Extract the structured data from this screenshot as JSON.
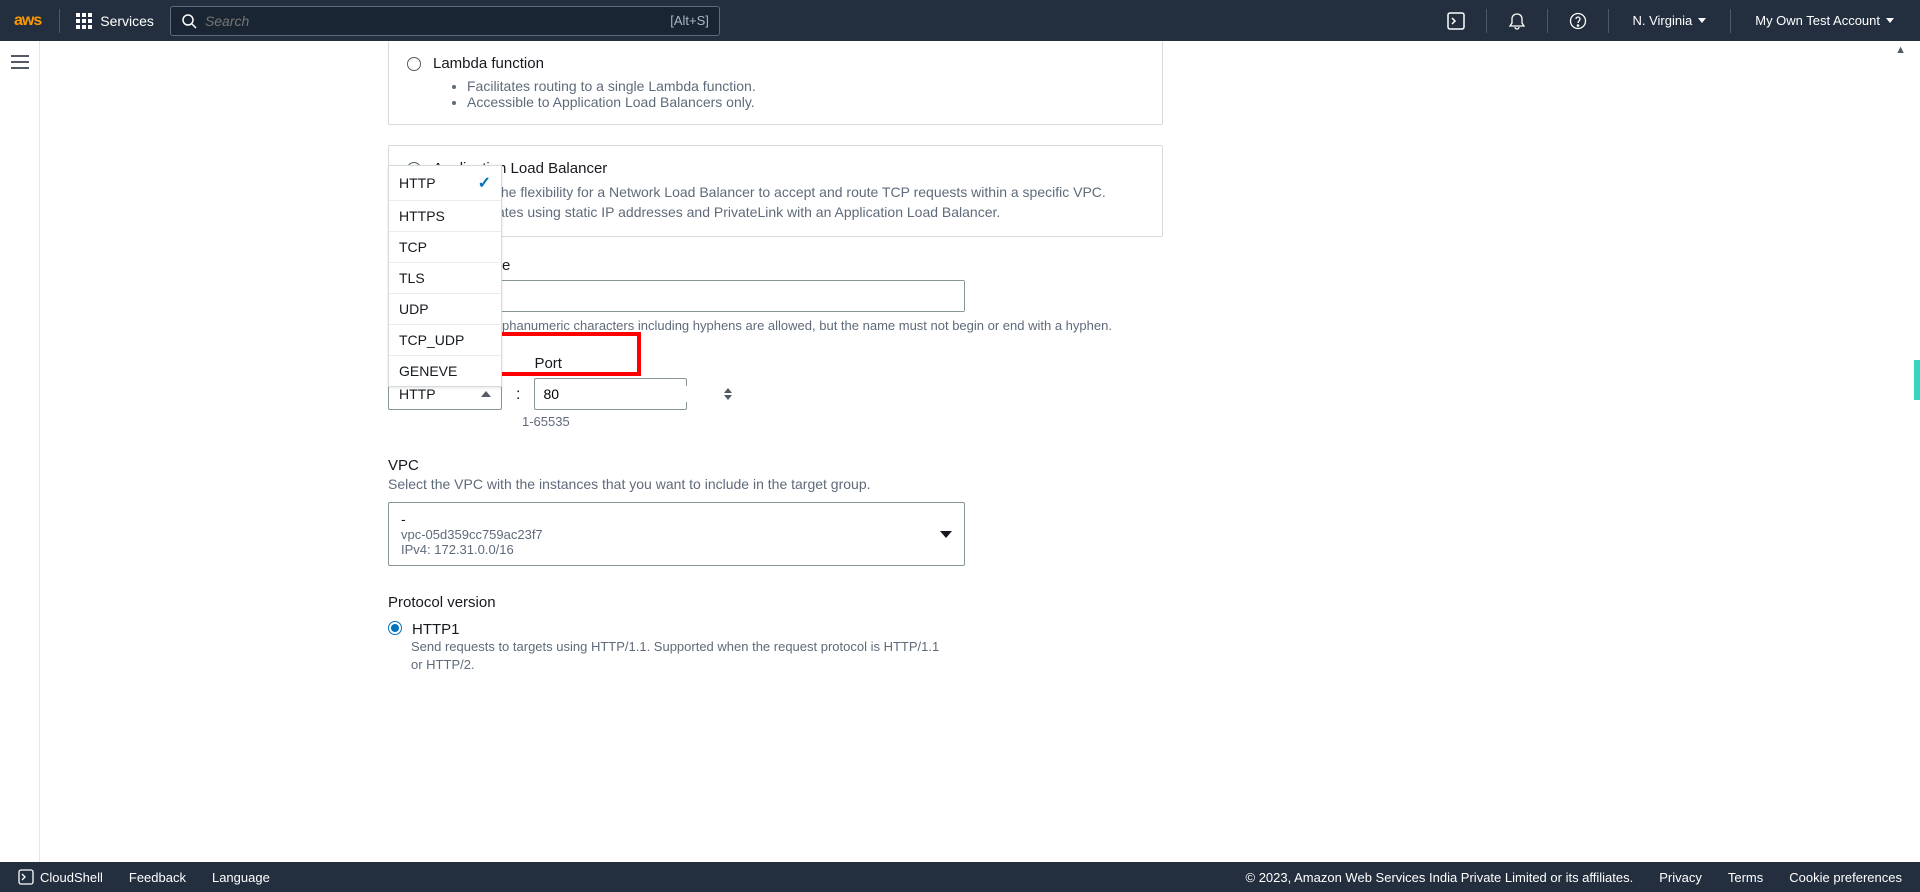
{
  "header": {
    "services": "Services",
    "search_placeholder": "Search",
    "search_shortcut": "[Alt+S]",
    "region": "N. Virginia",
    "account": "My Own Test Account"
  },
  "lambda_option": {
    "title": "Lambda function",
    "bullets": [
      "Facilitates routing to a single Lambda function.",
      "Accessible to Application Load Balancers only."
    ]
  },
  "alb_option": {
    "title": "Application Load Balancer",
    "desc_p1_fragment": "the flexibility for a Network Load Balancer to accept and route TCP requests within a specific VPC.",
    "desc_p2_fragment": "ates using static IP addresses and PrivateLink with an Application Load Balancer."
  },
  "name_label_fragment": "e",
  "name_help_fragment": "phanumeric characters including hyphens are allowed, but the name must not begin or end with a hyphen.",
  "protocol": {
    "selected": "HTTP",
    "options": [
      "HTTP",
      "HTTPS",
      "TCP",
      "TLS",
      "UDP",
      "TCP_UDP",
      "GENEVE"
    ]
  },
  "port": {
    "label": "Port",
    "value": "80",
    "range": "1-65535"
  },
  "vpc": {
    "title": "VPC",
    "desc": "Select the VPC with the instances that you want to include in the target group.",
    "selected_name": "-",
    "selected_id": "vpc-05d359cc759ac23f7",
    "selected_ipv4": "IPv4: 172.31.0.0/16"
  },
  "protocol_version": {
    "title": "Protocol version",
    "opt1_label": "HTTP1",
    "opt1_desc": "Send requests to targets using HTTP/1.1. Supported when the request protocol is HTTP/1.1 or HTTP/2."
  },
  "footer": {
    "cloudshell": "CloudShell",
    "feedback": "Feedback",
    "language": "Language",
    "copyright": "© 2023, Amazon Web Services India Private Limited or its affiliates.",
    "privacy": "Privacy",
    "terms": "Terms",
    "cookies": "Cookie preferences"
  }
}
